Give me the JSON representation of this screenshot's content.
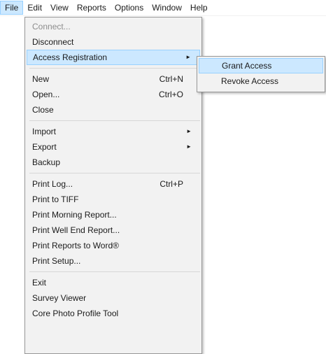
{
  "menubar": {
    "items": [
      {
        "label": "File",
        "active": true
      },
      {
        "label": "Edit"
      },
      {
        "label": "View"
      },
      {
        "label": "Reports"
      },
      {
        "label": "Options"
      },
      {
        "label": "Window"
      },
      {
        "label": "Help"
      }
    ]
  },
  "file_menu": {
    "groups": [
      [
        {
          "label": "Connect...",
          "disabled": true
        },
        {
          "label": "Disconnect"
        },
        {
          "label": "Access Registration",
          "submenu": true,
          "highlighted": true
        }
      ],
      [
        {
          "label": "New",
          "shortcut": "Ctrl+N"
        },
        {
          "label": "Open...",
          "shortcut": "Ctrl+O"
        },
        {
          "label": "Close"
        }
      ],
      [
        {
          "label": "Import",
          "submenu": true
        },
        {
          "label": "Export",
          "submenu": true
        },
        {
          "label": "Backup"
        }
      ],
      [
        {
          "label": "Print Log...",
          "shortcut": "Ctrl+P"
        },
        {
          "label": "Print to TIFF"
        },
        {
          "label": "Print Morning Report..."
        },
        {
          "label": "Print Well End Report..."
        },
        {
          "label": "Print Reports to Word®"
        },
        {
          "label": "Print Setup..."
        }
      ],
      [
        {
          "label": "Exit"
        },
        {
          "label": "Survey Viewer"
        },
        {
          "label": "Core Photo Profile Tool"
        }
      ]
    ]
  },
  "access_registration_submenu": {
    "items": [
      {
        "label": "Grant Access",
        "highlighted": true
      },
      {
        "label": "Revoke Access"
      }
    ]
  },
  "submenu_arrow_glyph": "►",
  "colors": {
    "highlight_fill": "#cce8ff",
    "highlight_border": "#99d1ff",
    "menu_background": "#f2f2f2",
    "disabled_text": "#8d8d8d"
  }
}
